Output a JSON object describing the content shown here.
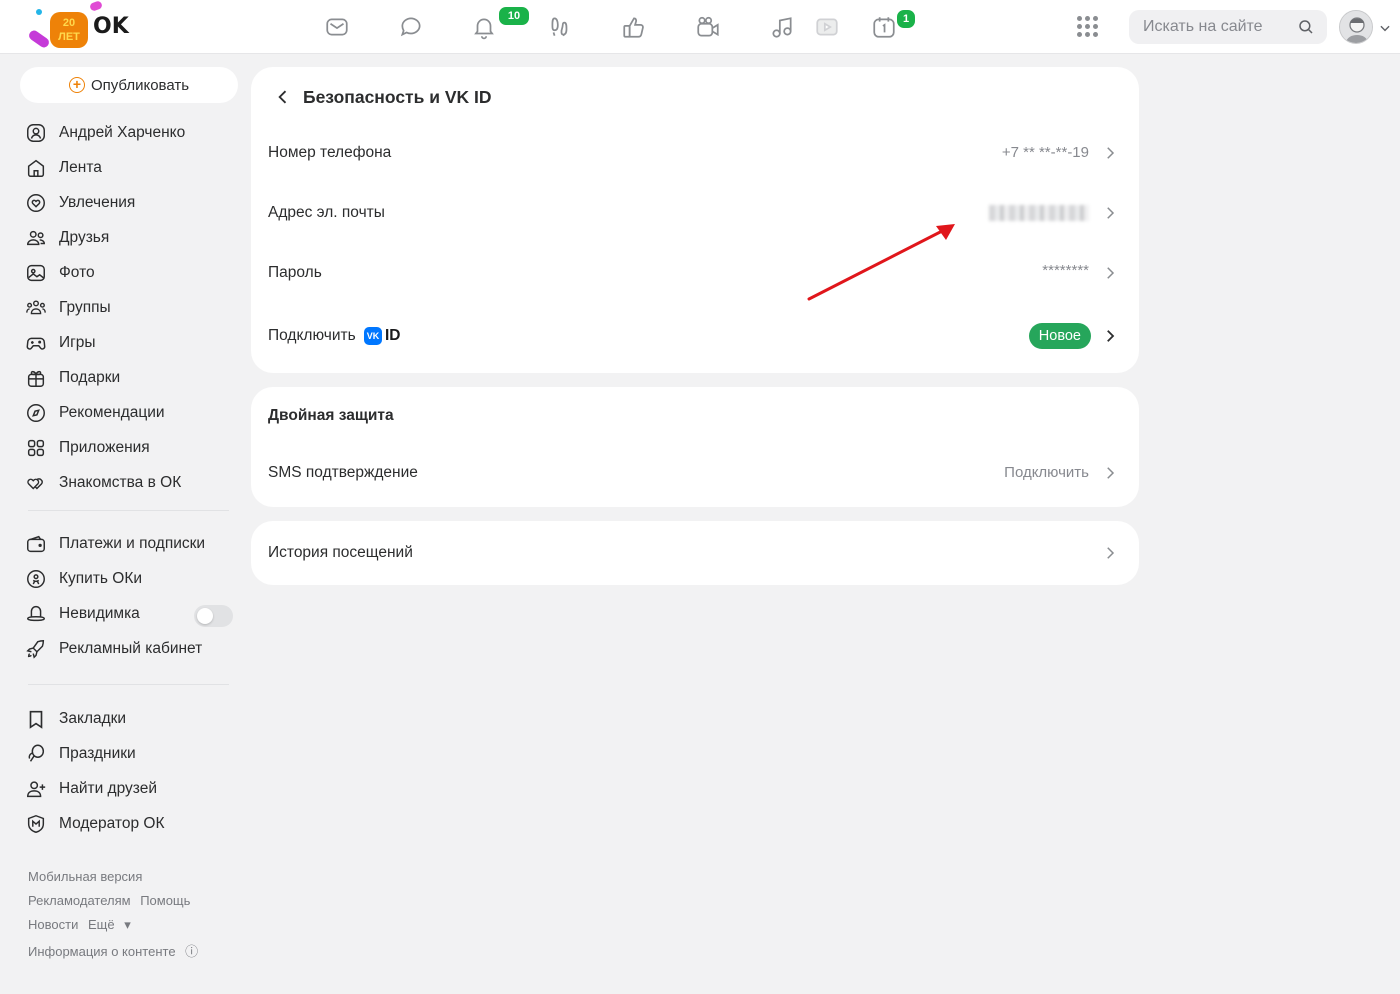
{
  "logo": {
    "badge_top": "20",
    "badge_bottom": "ЛЕТ",
    "text": "OK"
  },
  "topbar": {
    "icons": [
      "mail-icon",
      "chat-icon",
      "bell-icon",
      "footprints-icon",
      "like-icon",
      "video-camera-icon",
      "music-note-icon",
      "video-icon",
      "calendar-icon"
    ],
    "notifications_badge": "10",
    "calendar_badge": "1",
    "search_placeholder": "Искать на сайте"
  },
  "sidebar": {
    "publish_label": "Опубликовать",
    "items": [
      {
        "label": "Андрей Харченко",
        "icon": "profile-icon"
      },
      {
        "label": "Лента",
        "icon": "home-icon"
      },
      {
        "label": "Увлечения",
        "icon": "hobby-icon"
      },
      {
        "label": "Друзья",
        "icon": "friends-icon"
      },
      {
        "label": "Фото",
        "icon": "photo-icon"
      },
      {
        "label": "Группы",
        "icon": "groups-icon"
      },
      {
        "label": "Игры",
        "icon": "gamepad-icon"
      },
      {
        "label": "Подарки",
        "icon": "gift-icon"
      },
      {
        "label": "Рекомендации",
        "icon": "compass-icon"
      },
      {
        "label": "Приложения",
        "icon": "apps-icon"
      },
      {
        "label": "Знакомства в ОК",
        "icon": "hearts-icon"
      }
    ],
    "items2": [
      {
        "label": "Платежи и подписки",
        "icon": "wallet-icon"
      },
      {
        "label": "Купить ОКи",
        "icon": "ok-coin-icon"
      },
      {
        "label": "Невидимка",
        "icon": "hat-icon",
        "toggle_on": false
      },
      {
        "label": "Рекламный кабинет",
        "icon": "rocket-icon"
      }
    ],
    "items3": [
      {
        "label": "Закладки",
        "icon": "bookmark-icon"
      },
      {
        "label": "Праздники",
        "icon": "balloon-icon"
      },
      {
        "label": "Найти друзей",
        "icon": "add-friend-icon"
      },
      {
        "label": "Модератор ОК",
        "icon": "moderator-shield-icon"
      }
    ],
    "footer": {
      "mobile": "Мобильная версия",
      "advertisers": "Рекламодателям",
      "help": "Помощь",
      "news": "Новости",
      "more": "Ещё",
      "content_info": "Информация о контенте"
    }
  },
  "security": {
    "title": "Безопасность и VK ID",
    "rows": [
      {
        "label": "Номер телефона",
        "value": "+7 ** **-**-19"
      },
      {
        "label": "Адрес эл. почты",
        "value": ""
      },
      {
        "label": "Пароль",
        "value": "********"
      },
      {
        "label": "Подключить",
        "vk_logo": "VK",
        "vk_text": "ID",
        "pill": "Новое"
      }
    ]
  },
  "two_factor": {
    "title": "Двойная защита",
    "row_label": "SMS подтверждение",
    "row_value": "Подключить"
  },
  "history": {
    "label": "История посещений"
  },
  "colors": {
    "accent": "#ee8208",
    "badge": "#1ab249",
    "new_pill": "#26a65b",
    "vk": "#0077ff",
    "annotation_arrow": "#e0161b"
  }
}
